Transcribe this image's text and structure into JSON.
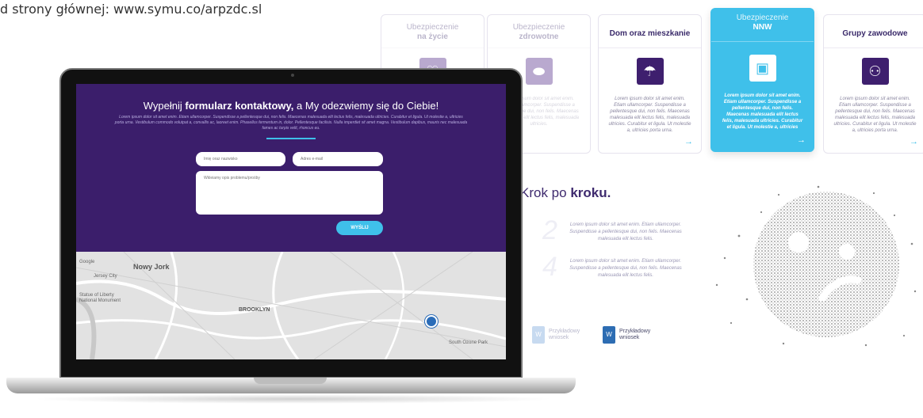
{
  "caption": "d strony głównej: www.symu.co/arpzdc.sl",
  "cards": [
    {
      "line1": "Ubezpieczenie",
      "line2": "na życie",
      "icon": "heart-icon",
      "glyph": "♡",
      "text": "",
      "arrow": ""
    },
    {
      "line1": "Ubezpieczenie",
      "line2": "zdrowotne",
      "icon": "pills-icon",
      "glyph": "⬬",
      "text": "Lorem ipsum dolor sit amet enim. Etiam ullamcorper. Suspendisse a pellentesque dui, non felis. Maecenas malesuada elit lectus felis, malesuada ultricies.",
      "arrow": ""
    },
    {
      "line1": "",
      "line2": "Dom oraz mieszkanie",
      "icon": "umbrella-icon",
      "glyph": "☂",
      "text": "Lorem ipsum dolor sit amet enim. Etiam ullamcorper. Suspendisse a pellentesque dui, non felis. Maecenas malesuada elit lectus felis, malesuada ultricies. Curabitur et ligula. Ut molestie a, ultricies porta urna.",
      "arrow": "→"
    },
    {
      "line1": "Ubezpieczenie",
      "line2": "NNW",
      "icon": "bus-icon",
      "glyph": "▣",
      "text": "Lorem ipsum dolor sit amet enim. Etiam ullamcorper. Suspendisse a pellentesque dui, non felis. Maecenas malesuada elit lectus felis, malesuada ultricies. Curabitur et ligula. Ut molestie a, ultricies porta urna.",
      "arrow": "→"
    },
    {
      "line1": "",
      "line2": "Grupy zawodowe",
      "icon": "users-icon",
      "glyph": "⚇",
      "text": "Lorem ipsum dolor sit amet enim. Etiam ullamcorper. Suspendisse a pellentesque dui, non felis. Maecenas malesuada elit lectus felis, malesuada ultricies. Curabitur et ligula. Ut molestie a, ultricies porta urna.",
      "arrow": "→"
    }
  ],
  "steps": {
    "title_normal": "Krok po ",
    "title_bold": "kroku.",
    "items": [
      {
        "num": "2",
        "text": "Lorem ipsum dolor sit amet enim. Etiam ullamcorper. Suspendisse a pellentesque dui, non felis. Maecenas malesuada elit lectus felis."
      },
      {
        "num": "4",
        "text": "Lorem ipsum dolor sit amet enim. Etiam ullamcorper. Suspendisse a pellentesque dui, non felis. Maecenas malesuada elit lectus felis."
      }
    ],
    "docs": [
      {
        "label1": "Przykładowy",
        "label2": "wniosek",
        "icon": "document-icon",
        "glyph": "W"
      },
      {
        "label1": "Przykładowy",
        "label2": "wniosek",
        "icon": "document-icon",
        "glyph": "W"
      }
    ]
  },
  "form": {
    "title_pre": "Wypełnij ",
    "title_bold": "formularz kontaktowy,",
    "title_post": " a My odezwiemy się do Ciebie!",
    "text": "Lorem ipsum dolor sit amet enim. Etiam ullamcorper. Suspendisse a pellentesque dui, non felis. Maecenas malesuada elit lectus felis, malesuada ultricies. Curabitur et ligula. Ut molestie a, ultricies porta urna. Vestibulum commodo volutpat a, convallis ac, laoreet enim. Phasellus fermentum in, dolor. Pellentesque facilisis. Nulla imperdiet sit amet magna. Vestibulum dapibus, mauris nec malesuada fames ac turpis velit, rhoncus eu.",
    "name_placeholder": "Imię oraz nazwisko",
    "email_placeholder": "Adres e-mail",
    "message_placeholder": "Wkleiamy opis problemu/prośby",
    "send_label": "WYŚLIJ"
  },
  "map": {
    "city": "Nowy Jork",
    "district": "BROOKLYN",
    "small_labels": [
      "Google",
      "Statue of Liberty",
      "National Monument",
      "Jersey City",
      "South Ozone Park"
    ]
  }
}
